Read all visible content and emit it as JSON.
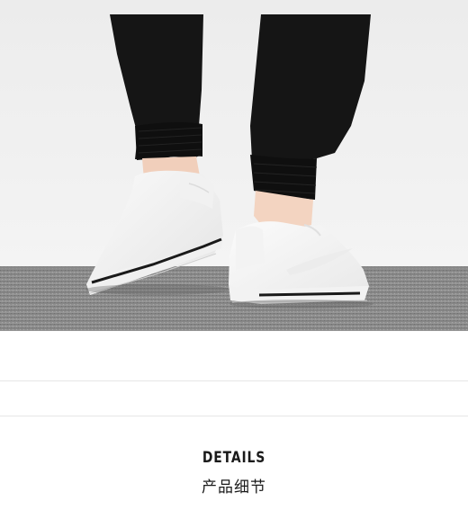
{
  "photo": {
    "subject": "white-sneakers-on-feet",
    "colors": {
      "wall": "#eeeeee",
      "carpet": "#8c8c8c",
      "pants": "#141414",
      "skin": "#f2d2bf",
      "shoe": "#f7f7f7",
      "sole_stripe": "#1a1a1a"
    }
  },
  "section": {
    "title": "DETAILS",
    "subtitle": "产品细节"
  }
}
